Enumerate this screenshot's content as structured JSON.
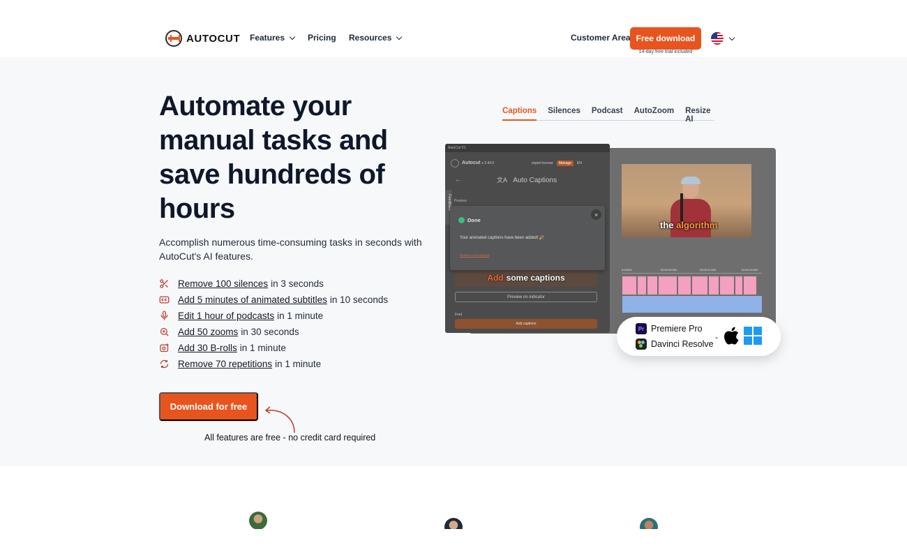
{
  "nav": {
    "logo_text": "AUTOCUT",
    "features": "Features",
    "pricing": "Pricing",
    "resources": "Resources",
    "customer_area": "Customer Area",
    "free_download": "Free download",
    "trial_note": "14-day free trial included",
    "language_flag": "us-flag-icon"
  },
  "hero": {
    "title": "Automate your manual tasks and save hundreds of hours",
    "lead": "Accomplish numerous time-consuming tasks in seconds with AutoCut's AI features.",
    "features": [
      {
        "icon": "scissors-icon",
        "link": "Remove 100 silences",
        "rest": "in 3 seconds"
      },
      {
        "icon": "closed-captions-icon",
        "link": "Add 5 minutes of animated subtitles",
        "rest": "in 10 seconds"
      },
      {
        "icon": "microphone-icon",
        "link": "Edit 1 hour of podcasts",
        "rest": "in 1 minute"
      },
      {
        "icon": "zoom-in-icon",
        "link": "Add 50 zooms",
        "rest": "in 30 seconds"
      },
      {
        "icon": "camera-plus-icon",
        "link": "Add 30 B-rolls",
        "rest": "in 1 minute"
      },
      {
        "icon": "repeat-icon",
        "link": "Remove 70 repetitions",
        "rest": "in 1 minute"
      }
    ],
    "cta": "Download for free",
    "cta_note": "All features are free - no credit card required"
  },
  "tabs": [
    "Captions",
    "Silences",
    "Podcast",
    "AutoZoom",
    "Resize AI"
  ],
  "active_tab": "Captions",
  "app": {
    "window_title": "AutoCut V1",
    "app_name": "Autocut",
    "version": "v 2.44.0",
    "license": "expert license",
    "manage": "Manage",
    "lang": "EN",
    "section": "Auto Captions",
    "preview_label": "Preview",
    "feedback": "Feedback",
    "done_title": "Done",
    "done_message": "Your animated captions have been added! 🎉",
    "done_link": "Review AutoCaptions",
    "caption_highlight": "Add",
    "caption_rest": "some captions",
    "preview_button": "Preview on indicator",
    "font_label": "Font",
    "add_button": "Add captions",
    "video_subtitle_a": "the",
    "video_subtitle_b": "algorithm",
    "timeline_marks": [
      "0:00000",
      "00:00:05:000",
      "00:00:10:000",
      "00:00:15:000"
    ]
  },
  "platforms": {
    "premiere": "Premiere Pro",
    "premiere_icon": "Pr",
    "davinci": "Davinci Resolve",
    "dash": "-",
    "os_icons": [
      "apple-icon",
      "windows-icon"
    ]
  },
  "colors": {
    "accent": "#e8541e",
    "hero_bg": "#f7f8fa"
  }
}
